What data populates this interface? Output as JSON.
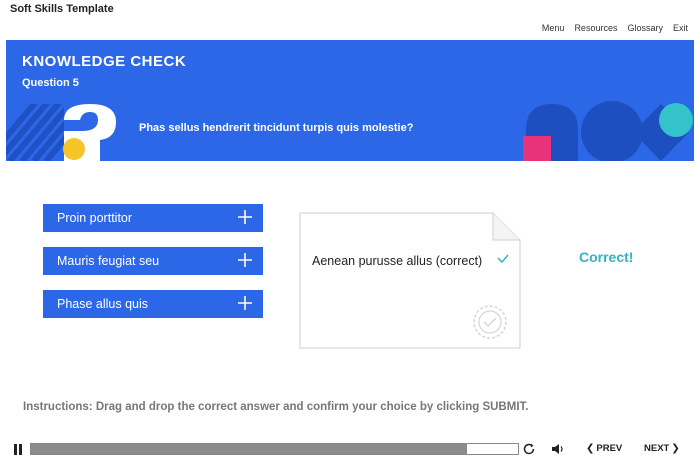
{
  "app": {
    "title": "Soft Skills Template"
  },
  "nav": {
    "menu": "Menu",
    "resources": "Resources",
    "glossary": "Glossary",
    "exit": "Exit"
  },
  "banner": {
    "heading": "KNOWLEDGE CHECK",
    "question_number": "Question 5",
    "question_text": "Phas sellus hendrerit tincidunt turpis quis molestie?"
  },
  "options": [
    {
      "label": "Proin porttitor"
    },
    {
      "label": "Mauris feugiat seu"
    },
    {
      "label": "Phase allus quis"
    }
  ],
  "drop_zone": {
    "answer": "Aenean purusse allus (correct)"
  },
  "feedback": {
    "text": "Correct!"
  },
  "instructions": {
    "text": "Instructions: Drag and drop the correct answer and confirm your choice by clicking SUBMIT."
  },
  "player": {
    "progress_fraction": 0.895,
    "prev_label": "PREV",
    "next_label": "NEXT"
  },
  "colors": {
    "brand_blue": "#2b67e6",
    "correct": "#36b2c3",
    "accent_yellow": "#f5c527",
    "accent_pink": "#e8337a",
    "accent_teal": "#33c3c9"
  },
  "icons": [
    "plus-icon",
    "check-icon",
    "stamp-icon",
    "pause-icon",
    "replay-icon",
    "volume-icon",
    "chevron-left-icon",
    "chevron-right-icon",
    "question-mark-icon"
  ]
}
